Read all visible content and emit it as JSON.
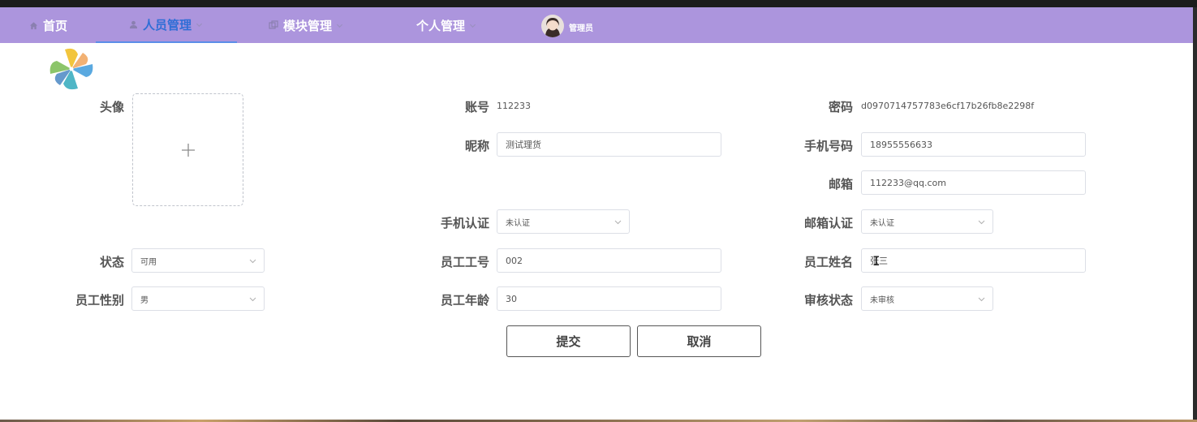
{
  "nav": {
    "items": [
      {
        "label": "首页",
        "icon": "home-icon"
      },
      {
        "label": "人员管理",
        "icon": "user-icon",
        "active": true
      },
      {
        "label": "模块管理",
        "icon": "module-icon"
      },
      {
        "label": "个人管理"
      }
    ],
    "user": {
      "label": "管理员"
    }
  },
  "form": {
    "avatar_label": "头像",
    "account_label": "账号",
    "account_value": "112233",
    "password_label": "密码",
    "password_value": "d0970714757783e6cf17b26fb8e2298f",
    "nickname_label": "昵称",
    "nickname_value": "测试理货",
    "phone_label": "手机号码",
    "phone_value": "18955556633",
    "email_label": "邮箱",
    "email_value": "112233@qq.com",
    "phone_verify_label": "手机认证",
    "phone_verify_value": "未认证",
    "email_verify_label": "邮箱认证",
    "email_verify_value": "未认证",
    "status_label": "状态",
    "status_value": "可用",
    "emp_no_label": "员工工号",
    "emp_no_value": "002",
    "emp_name_label": "员工姓名",
    "emp_name_value": "张三",
    "gender_label": "员工性别",
    "gender_value": "男",
    "age_label": "员工年龄",
    "age_value": "30",
    "review_label": "审核状态",
    "review_value": "未审核"
  },
  "actions": {
    "submit": "提交",
    "cancel": "取消"
  },
  "colors": {
    "nav_bg": "#ac95dd",
    "nav_active": "#2f6ed6"
  }
}
